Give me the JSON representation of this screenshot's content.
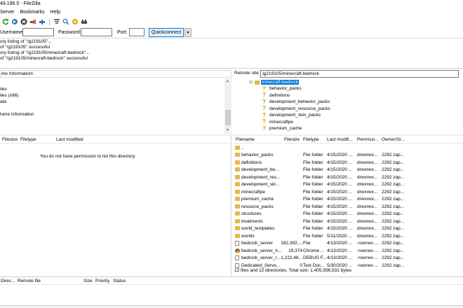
{
  "window": {
    "title": "49.196.5 - FileZilla"
  },
  "menu": {
    "items": [
      "Server",
      "Bookmarks",
      "Help"
    ]
  },
  "toolbar": {
    "icons": [
      "refresh-icon",
      "process-queue-icon",
      "cancel-icon",
      "disconnect-icon",
      "reconnect-icon",
      "filter-icon",
      "search-icon",
      "compare-icon",
      "binoculars-icon"
    ]
  },
  "quickconnect": {
    "username_label": "Username:",
    "password_label": "Password:",
    "port_label": "Port:",
    "button_label": "Quickconnect",
    "dropdown_arrow": "▼"
  },
  "log": {
    "lines": [
      "ory listing of \"/g219105\"...",
      "of \"/g219105\" successful",
      "ory listing of \"/g219105/minecraft-bedrock\"...",
      "of \"/g219105/minecraft-bedrock\" successful"
    ]
  },
  "local": {
    "site_path": "me Information\\",
    "tree": [
      "iles",
      "iles (x86)",
      "ata",
      "lume Information"
    ],
    "columns": [
      "Filesize",
      "Filetype",
      "Last modified"
    ],
    "message": "You do not have permission to list this directory"
  },
  "remote": {
    "site_label": "Remote site:",
    "site_path": "/g219105/minecraft-bedrock",
    "tree_root": "minecraft-bedrock",
    "tree_children": [
      "behavior_packs",
      "definitions",
      "development_behavior_packs",
      "development_resource_packs",
      "development_skin_packs",
      "minecraftpe",
      "premium_cache"
    ],
    "columns": [
      "Filename",
      "Filesize",
      "Filetype",
      "Last modifi...",
      "Permissi...",
      "Owner/Gr..."
    ],
    "rows": [
      {
        "icon": "folder",
        "name": "..",
        "size": "",
        "type": "",
        "modified": "",
        "perm": "",
        "owner": ""
      },
      {
        "icon": "folder",
        "name": "behavior_packs",
        "size": "",
        "type": "File folder",
        "modified": "4/15/2020 ...",
        "perm": "drwxrwx...",
        "owner": "2292 zap..."
      },
      {
        "icon": "folder",
        "name": "definitions",
        "size": "",
        "type": "File folder",
        "modified": "4/15/2020 ...",
        "perm": "drwxrwx...",
        "owner": "2292 zap..."
      },
      {
        "icon": "folder",
        "name": "development_be...",
        "size": "",
        "type": "File folder",
        "modified": "4/15/2020 ...",
        "perm": "drwxrwx...",
        "owner": "2292 zap..."
      },
      {
        "icon": "folder",
        "name": "development_res...",
        "size": "",
        "type": "File folder",
        "modified": "4/15/2020 ...",
        "perm": "drwxrwx...",
        "owner": "2292 zap..."
      },
      {
        "icon": "folder",
        "name": "development_ski...",
        "size": "",
        "type": "File folder",
        "modified": "4/15/2020 ...",
        "perm": "drwxrwx...",
        "owner": "2292 zap..."
      },
      {
        "icon": "folder",
        "name": "minecraftpe",
        "size": "",
        "type": "File folder",
        "modified": "4/15/2020 ...",
        "perm": "drwxrwx...",
        "owner": "2292 zap..."
      },
      {
        "icon": "folder",
        "name": "premium_cache",
        "size": "",
        "type": "File folder",
        "modified": "4/15/2020 ...",
        "perm": "drwxrwx...",
        "owner": "2292 zap..."
      },
      {
        "icon": "folder",
        "name": "resource_packs",
        "size": "",
        "type": "File folder",
        "modified": "4/15/2020 ...",
        "perm": "drwxrwx...",
        "owner": "2292 zap..."
      },
      {
        "icon": "folder",
        "name": "structures",
        "size": "",
        "type": "File folder",
        "modified": "4/15/2020 ...",
        "perm": "drwxrwx...",
        "owner": "2292 zap..."
      },
      {
        "icon": "folder",
        "name": "treatments",
        "size": "",
        "type": "File folder",
        "modified": "4/15/2020 ...",
        "perm": "drwxrwx...",
        "owner": "2292 zap..."
      },
      {
        "icon": "folder",
        "name": "world_templates",
        "size": "",
        "type": "File folder",
        "modified": "4/15/2020 ...",
        "perm": "drwxrwx...",
        "owner": "2292 zap..."
      },
      {
        "icon": "folder",
        "name": "worlds",
        "size": "",
        "type": "File folder",
        "modified": "5/11/2020 ...",
        "perm": "drwxrwx...",
        "owner": "2292 zap..."
      },
      {
        "icon": "file",
        "name": "bedrock_server",
        "size": "182,392,...",
        "type": "File",
        "modified": "4/13/2020 ...",
        "perm": "-rwxrwx-...",
        "owner": "2292 zap..."
      },
      {
        "icon": "chrome",
        "name": "bedrock_server_h...",
        "size": "19,374",
        "type": "Chrome ...",
        "modified": "4/13/2020 ...",
        "perm": "-rwxrwx-...",
        "owner": "2292 zap..."
      },
      {
        "icon": "file",
        "name": "bedrock_server_r...",
        "size": "1,222,46...",
        "type": "DEBUG F...",
        "modified": "4/13/2020 ...",
        "perm": "-rwxrwx-...",
        "owner": "2292 zap..."
      },
      {
        "icon": "file",
        "name": "Dedicated_Serve...",
        "size": "0",
        "type": "Text Doc...",
        "modified": "5/30/2020 ...",
        "perm": "-rwxrwx-...",
        "owner": "2292 zap..."
      }
    ],
    "status": "12 files and 12 directories. Total size: 1,405,596,531 bytes"
  },
  "queue": {
    "columns": [
      "Direc...",
      "Remote file",
      "Size",
      "Priority",
      "Status"
    ]
  },
  "colors": {
    "selected_bg": "#0078d7",
    "folder": "#e8b64b",
    "accent": "#0078d7"
  }
}
